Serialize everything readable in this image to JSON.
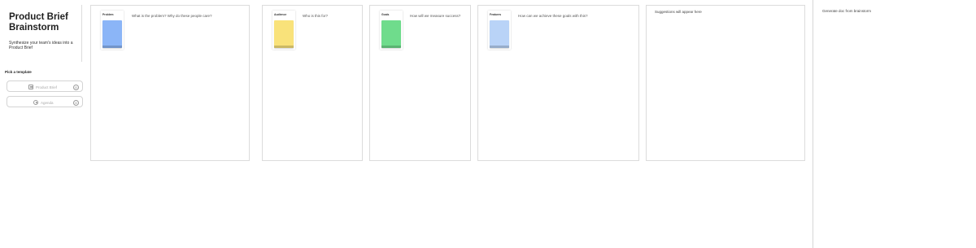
{
  "title_card": {
    "title": "Product Brief Brainstorm",
    "subtitle": "Synthesize your team's ideas into a Product Brief"
  },
  "template_panel": {
    "heading": "Pick a template",
    "buttons": [
      {
        "label": "Product Brief",
        "icon": "document-icon",
        "badge": "0"
      },
      {
        "label": "Agenda",
        "icon": "clock-icon",
        "badge": "0"
      }
    ]
  },
  "columns": [
    {
      "tag": "Problem",
      "question": "What is the problem? Why do these people care?",
      "sticky_color": "#8bb5f7"
    },
    {
      "tag": "Audience",
      "question": "Who is this for?",
      "sticky_color": "#f9e27a"
    },
    {
      "tag": "Goals",
      "question": "How will we measure success?",
      "sticky_color": "#6fdc8c"
    },
    {
      "tag": "Features",
      "question": "How can we achieve these goals with this?",
      "sticky_color": "#b9d3f7"
    }
  ],
  "suggestions_heading": "Suggestions will appear here",
  "generated_heading": "Generate doc from brainstorm"
}
